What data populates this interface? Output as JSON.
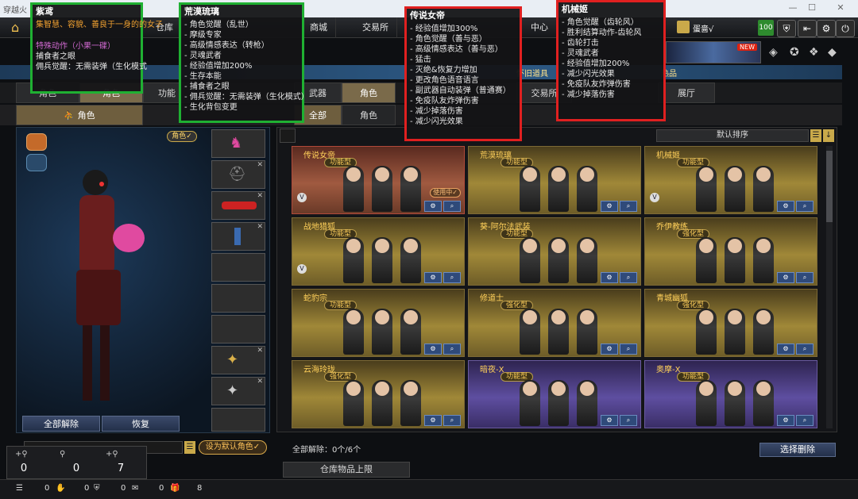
{
  "window": {
    "title": "穿越火"
  },
  "nav": {
    "items": [
      "仓库",
      "商城",
      "交易所",
      "中心"
    ],
    "username": "蛋啬√",
    "level": "100"
  },
  "banner": {
    "new_label": "NEW"
  },
  "bluebar": {
    "left": "怀旧道具",
    "right": "热品"
  },
  "tabs": [
    "角色",
    "功能",
    "武器",
    "角色",
    "交易所",
    "展厅"
  ],
  "subtabs": [
    "角色",
    "全部",
    "角色"
  ],
  "left": {
    "role_tag": "角色✓",
    "clear_all": "全部解除",
    "restore": "恢复",
    "set_default": "设为默认角色✓"
  },
  "stats": {
    "counts": [
      "0",
      "0",
      "7"
    ]
  },
  "footer": {
    "values": [
      "0",
      "0",
      "0",
      "0",
      "8"
    ]
  },
  "grid": {
    "sort_label": "默认排序",
    "cards": [
      {
        "name": "传说女帝",
        "tag": "功能型",
        "using": "使用中✓",
        "style": "red"
      },
      {
        "name": "荒漠琉璃",
        "tag": "功能型",
        "style": "gold"
      },
      {
        "name": "机械姬",
        "tag": "功能型",
        "style": "gold"
      },
      {
        "name": "战地猎狐",
        "tag": "功能型",
        "style": "gold"
      },
      {
        "name": "葵-阿尔法武装",
        "tag": "功能型",
        "style": "gold"
      },
      {
        "name": "乔伊教练",
        "tag": "强化型",
        "style": "gold"
      },
      {
        "name": "蛇豹宗",
        "tag": "功能型",
        "style": "gold"
      },
      {
        "name": "修道士",
        "tag": "强化型",
        "style": "gold"
      },
      {
        "name": "青城幽狐",
        "tag": "强化型",
        "style": "gold"
      },
      {
        "name": "云海玲珑",
        "tag": "强化型",
        "style": "gold"
      },
      {
        "name": "暗夜-X",
        "tag": "功能型",
        "style": "purple"
      },
      {
        "name": "奥摩-X",
        "tag": "功能型",
        "style": "purple"
      }
    ],
    "clear_all_text": "全部解除：0个/6个",
    "delete_selected": "选择删除",
    "storage_limit": "仓库物品上限"
  },
  "overlays": {
    "ziyan": {
      "title": "紫鸢",
      "lines": [
        "集智慧、容貌、善良于一身的的女子",
        "",
        "特殊动作（小果一碟）",
        "捕食者之眼",
        "佣兵觉醒：无需装弹（生化模式"
      ]
    },
    "huangmo": {
      "title": "荒漠琉璃",
      "lines": [
        "- 角色觉醒（乱世）",
        "- 摩级专家",
        "- 高级情感表达（转枪）",
        "- 灵魂武者",
        "- 经验值增加200%",
        "- 生存本能",
        "- 捕食者之眼",
        "- 佣兵觉醒：无需装弹（生化模式）",
        "- 生化背包变更"
      ]
    },
    "chuanshuo": {
      "title": "传说女帝",
      "lines": [
        "- 经验值增加300%",
        "- 角色觉醒（善与恶）",
        "- 高级情感表达（善与恶）",
        "- 猛击",
        "- 灭绝&恢复力增加",
        "- 更改角色语音语言",
        "- 副武器自动装弹（普通赛）",
        "- 免疫队友炸弹伤害",
        "- 减少掉落伤害",
        "- 减少闪光效果"
      ]
    },
    "jixie": {
      "title": "机械姬",
      "lines": [
        "- 角色觉醒（齿轮风）",
        "- 胜利结算动作-齿轮风",
        "- 齿轮打击",
        "- 灵魂武者",
        "- 经验值增加200%",
        "- 减少闪光效果",
        "- 免疫队友炸弹伤害",
        "- 减少掉落伤害"
      ]
    }
  }
}
